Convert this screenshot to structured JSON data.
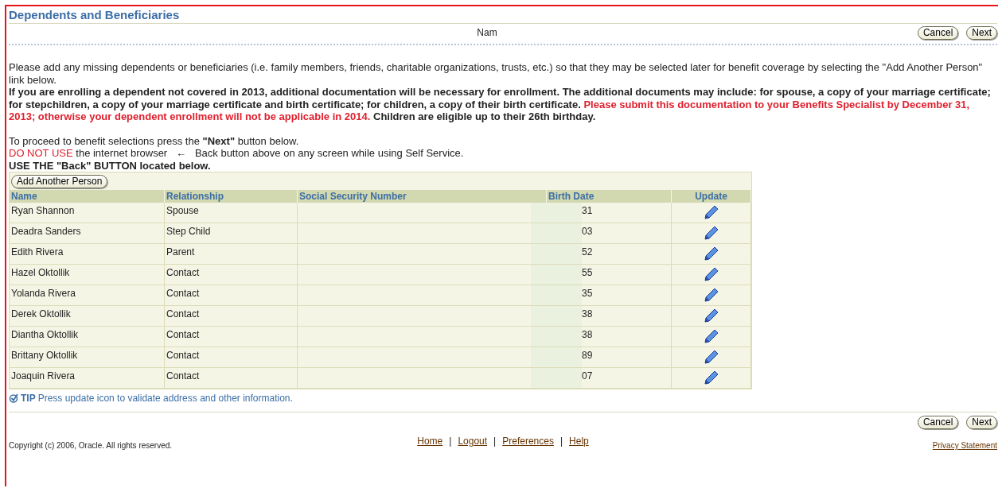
{
  "page": {
    "title": "Dependents and Beneficiaries",
    "step_label": "Nam"
  },
  "top_buttons": [
    {
      "label": "Cancel"
    },
    {
      "label": "Next"
    }
  ],
  "instructions": [
    {
      "kind": "plain",
      "text": "Please add any missing dependents or beneficiaries (i.e. family members, friends, charitable organizations, trusts, etc.) so that they may be selected later for benefit coverage by selecting the \"Add Another Person\" link below."
    },
    {
      "kind": "notice",
      "text": "If you are enrolling a dependent not covered in 2013, additional documentation will be necessary for enrollment. The additional documents may include: for spouse, a copy of your marriage certificate; for stepchildren, a copy of your marriage certificate and birth certificate; for children, a copy of their birth certificate.",
      "warning": "Please submit this documentation to your Benefits Specialist by December 31, 2013; otherwise your dependent enrollment will not be applicable in 2014.",
      "after": "Children are eligible up to their 26th birthday."
    }
  ],
  "proceed": {
    "text": "To proceed to benefit selections press the **\"Next\"** button below.",
    "warning": "DO NOT USE",
    "browser_text": "the internet browser",
    "arrow": "←",
    "back_text": "Back button above on any screen while using Self Service.",
    "use_back": "USE THE \"Back\" BUTTON located below."
  },
  "table": {
    "add_button": "Add Another Person",
    "columns": [
      "Name",
      "Relationship",
      "Social Security Number",
      "Birth Date",
      "Update"
    ],
    "rows": [
      {
        "name": "Ryan Shannon",
        "relationship": "Spouse",
        "birth_date": "31"
      },
      {
        "name": "Deadra Sanders",
        "relationship": "Step Child",
        "birth_date": "03"
      },
      {
        "name": "Edith Rivera",
        "relationship": "Parent",
        "birth_date": "52"
      },
      {
        "name": "Hazel Oktollik",
        "relationship": "Contact",
        "birth_date": "55"
      },
      {
        "name": "Yolanda Rivera",
        "relationship": "Contact",
        "birth_date": "35"
      },
      {
        "name": "Derek Oktollik",
        "relationship": "Contact",
        "birth_date": "38"
      },
      {
        "name": "Diantha Oktollik",
        "relationship": "Contact",
        "birth_date": "38"
      },
      {
        "name": "Brittany Oktollik",
        "relationship": "Contact",
        "birth_date": "89"
      },
      {
        "name": "Joaquin Rivera",
        "relationship": "Contact",
        "birth_date": "07"
      }
    ]
  },
  "tip": {
    "label": "TIP",
    "text": "Press update icon to validate address and other information."
  },
  "bottom_buttons": [
    {
      "label": "Cancel"
    },
    {
      "label": "Next"
    }
  ],
  "footer": {
    "links": [
      "Home",
      "Logout",
      "Preferences",
      "Help"
    ],
    "separator": "|",
    "copyright": "Copyright (c) 2006, Oracle. All rights reserved.",
    "privacy": "Privacy Statement"
  }
}
